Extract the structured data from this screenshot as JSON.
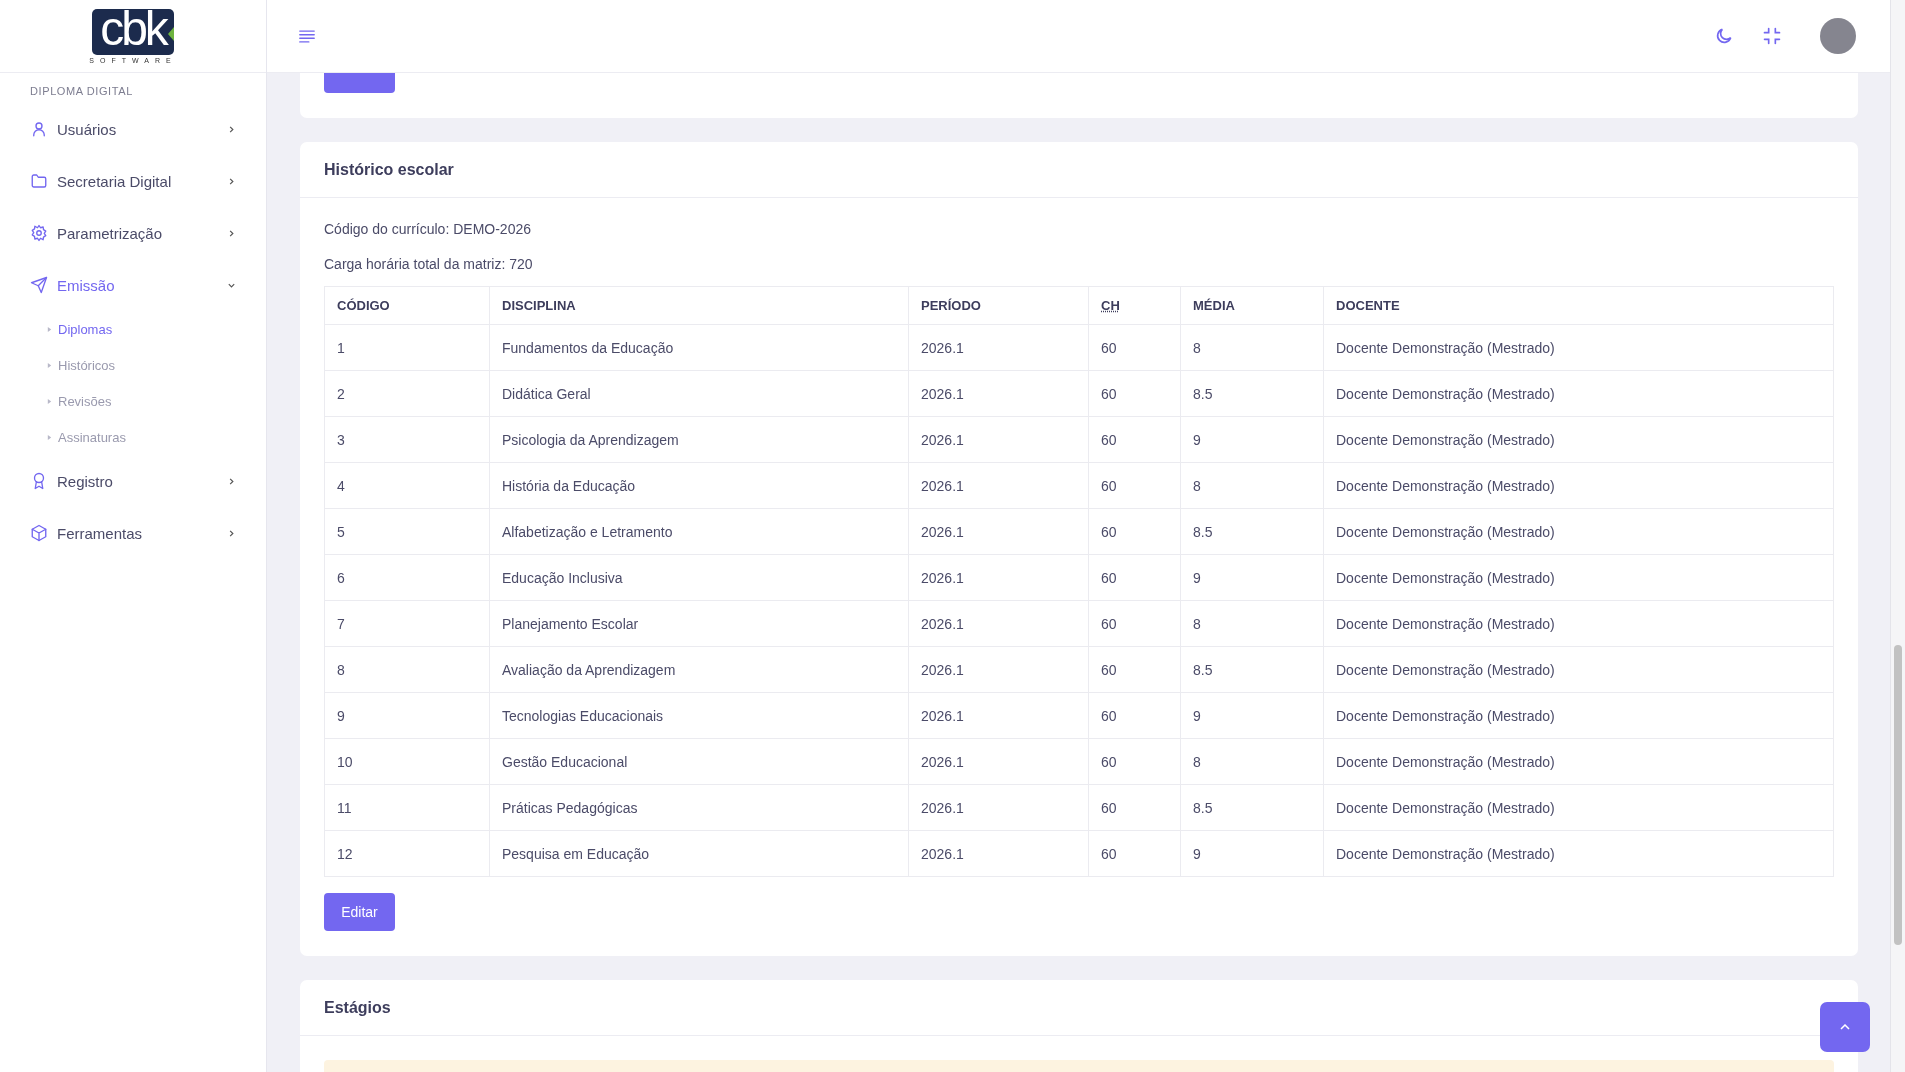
{
  "logo": {
    "name": "cbk",
    "tagline": "SOFTWARE"
  },
  "sidebar": {
    "section_label": "DIPLOMA DIGITAL",
    "items": [
      {
        "label": "Usuários",
        "expanded": false,
        "selected": false
      },
      {
        "label": "Secretaria Digital",
        "expanded": false,
        "selected": false
      },
      {
        "label": "Parametrização",
        "expanded": false,
        "selected": false
      },
      {
        "label": "Emissão",
        "expanded": true,
        "selected": true,
        "children": [
          {
            "label": "Diplomas",
            "selected": true
          },
          {
            "label": "Históricos",
            "selected": false
          },
          {
            "label": "Revisões",
            "selected": false
          },
          {
            "label": "Assinaturas",
            "selected": false
          }
        ]
      },
      {
        "label": "Registro",
        "expanded": false,
        "selected": false
      },
      {
        "label": "Ferramentas",
        "expanded": false,
        "selected": false
      }
    ]
  },
  "history_card": {
    "title": "Histórico escolar",
    "curriculum_code": "Código do currículo: DEMO-2026",
    "total_hours": "Carga horária total da matriz: 720",
    "table": {
      "columns": [
        "CÓDIGO",
        "DISCIPLINA",
        "PERÍODO",
        "CH",
        "MÉDIA",
        "DOCENTE"
      ],
      "rows": [
        [
          "1",
          "Fundamentos da Educação",
          "2026.1",
          "60",
          "8",
          "Docente Demonstração (Mestrado)"
        ],
        [
          "2",
          "Didática Geral",
          "2026.1",
          "60",
          "8.5",
          "Docente Demonstração (Mestrado)"
        ],
        [
          "3",
          "Psicologia da Aprendizagem",
          "2026.1",
          "60",
          "9",
          "Docente Demonstração (Mestrado)"
        ],
        [
          "4",
          "História da Educação",
          "2026.1",
          "60",
          "8",
          "Docente Demonstração (Mestrado)"
        ],
        [
          "5",
          "Alfabetização e Letramento",
          "2026.1",
          "60",
          "8.5",
          "Docente Demonstração (Mestrado)"
        ],
        [
          "6",
          "Educação Inclusiva",
          "2026.1",
          "60",
          "9",
          "Docente Demonstração (Mestrado)"
        ],
        [
          "7",
          "Planejamento Escolar",
          "2026.1",
          "60",
          "8",
          "Docente Demonstração (Mestrado)"
        ],
        [
          "8",
          "Avaliação da Aprendizagem",
          "2026.1",
          "60",
          "8.5",
          "Docente Demonstração (Mestrado)"
        ],
        [
          "9",
          "Tecnologias Educacionais",
          "2026.1",
          "60",
          "9",
          "Docente Demonstração (Mestrado)"
        ],
        [
          "10",
          "Gestão Educacional",
          "2026.1",
          "60",
          "8",
          "Docente Demonstração (Mestrado)"
        ],
        [
          "11",
          "Práticas Pedagógicas",
          "2026.1",
          "60",
          "8.5",
          "Docente Demonstração (Mestrado)"
        ],
        [
          "12",
          "Pesquisa em Educação",
          "2026.1",
          "60",
          "9",
          "Docente Demonstração (Mestrado)"
        ]
      ]
    },
    "edit_button": "Editar"
  },
  "internships_card": {
    "title": "Estágios"
  }
}
